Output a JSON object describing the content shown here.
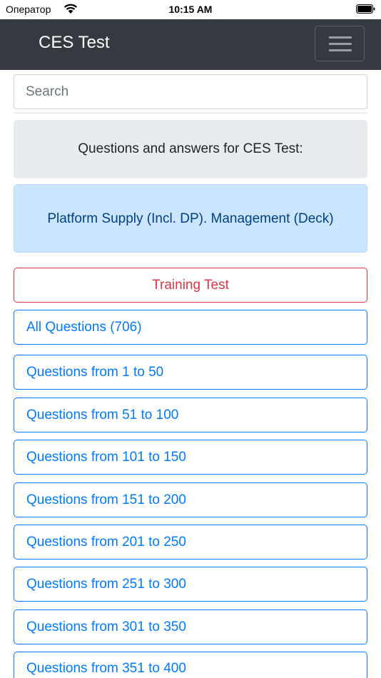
{
  "status_bar": {
    "carrier": "Оператор",
    "time": "10:15 AM",
    "wifi_icon": "wifi-icon",
    "battery_icon": "battery-icon"
  },
  "navbar": {
    "title": "CES Test",
    "menu_icon": "hamburger-menu-icon",
    "background_color": "#343a40"
  },
  "search": {
    "placeholder": "Search",
    "value": ""
  },
  "intro_text": "Questions and answers for CES Test:",
  "category_text": "Platform Supply (Incl. DP). Management (Deck)",
  "training_button": "Training Test",
  "question_buttons": [
    "All Questions (706)",
    "Questions from 1 to 50",
    "Questions from 51 to 100",
    "Questions from 101 to 150",
    "Questions from 151 to 200",
    "Questions from 201 to 250",
    "Questions from 251 to 300",
    "Questions from 301 to 350",
    "Questions from 351 to 400"
  ],
  "colors": {
    "primary": "#007bff",
    "danger": "#dc3545",
    "info_gray_bg": "#e9ecef",
    "info_blue_bg": "#cce5ff",
    "info_blue_text": "#004085"
  }
}
